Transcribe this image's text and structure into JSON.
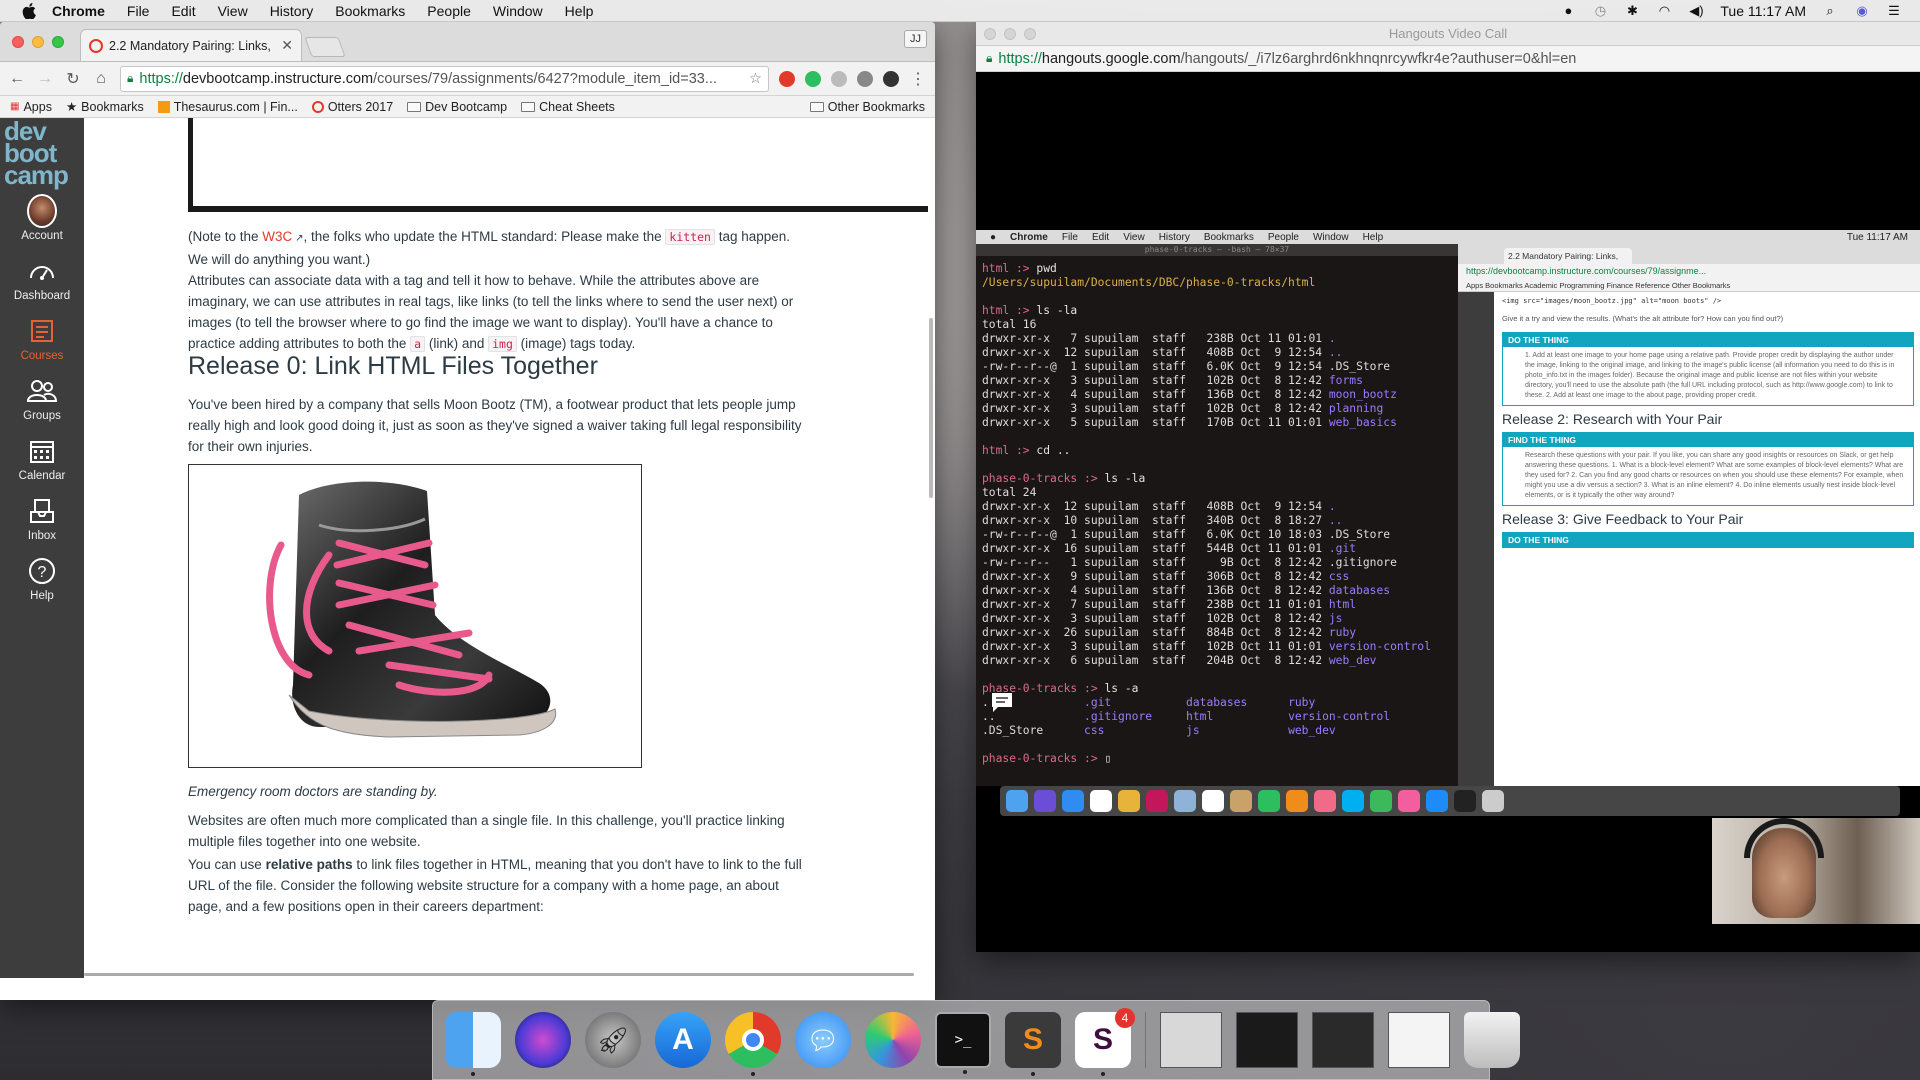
{
  "menubar": {
    "app": "Chrome",
    "items": [
      "File",
      "Edit",
      "View",
      "History",
      "Bookmarks",
      "People",
      "Window",
      "Help"
    ],
    "clock": "Tue 11:17 AM"
  },
  "left_window": {
    "tab_title": "2.2 Mandatory Pairing: Links, I",
    "profile": "JJ",
    "url_secure": "https://",
    "url_host": "devbootcamp.instructure.com",
    "url_path": "/courses/79/assignments/6427?module_item_id=33...",
    "bookmarks": [
      "Apps",
      "Bookmarks",
      "Thesaurus.com | Fin...",
      "Otters 2017",
      "Dev Bootcamp",
      "Cheat Sheets"
    ],
    "other_bookmarks": "Other Bookmarks"
  },
  "canvas_nav": {
    "logo": [
      "dev",
      "boot",
      "camp"
    ],
    "items": [
      "Account",
      "Dashboard",
      "Courses",
      "Groups",
      "Calendar",
      "Inbox",
      "Help"
    ]
  },
  "content": {
    "p1_a": "(Note to the ",
    "p1_link": "W3C",
    "p1_b": ", the folks who update the HTML standard: Please make the ",
    "p1_code": "kitten",
    "p1_c": " tag happen. We will do anything you want.)",
    "p2_a": "Attributes can associate data with a tag and tell it how to behave. While the attributes above are imaginary, we can use attributes in real tags, like links (to tell the links where to send the user next) or images (to tell the browser where to go find the image we want to display). You'll have a chance to practice adding attributes to both the ",
    "p2_code1": "a",
    "p2_b": " (link) and ",
    "p2_code2": "img",
    "p2_c": " (image) tags today.",
    "heading": "Release 0: Link HTML Files Together",
    "p3": "You've been hired by a company that sells Moon Bootz (TM), a footwear product that lets people jump really high and look good doing it, just as soon as they've signed a waiver taking full legal responsibility for their own injuries.",
    "caption": "Emergency room doctors are standing by.",
    "p4": "Websites are often much more complicated than a single file. In this challenge, you'll practice linking multiple files together into one website.",
    "p5_a": "You can use ",
    "p5_bold": "relative paths",
    "p5_b": " to link files together in HTML, meaning that you don't have to link to the full URL of the file. Consider the following website structure for a company with a home page, an about page, and a few positions open in their careers department:"
  },
  "hangouts": {
    "title": "Hangouts Video Call",
    "url_secure": "https://",
    "url_host": "hangouts.google.com",
    "url_path": "/hangouts/_/i7lz6arghrd6nkhnqnrcywfkr4e?authuser=0&hl=en"
  },
  "shared_screen": {
    "menubar": [
      "Chrome",
      "File",
      "Edit",
      "View",
      "History",
      "Bookmarks",
      "People",
      "Window",
      "Help"
    ],
    "clock": "Tue 11:17 AM",
    "terminal_title": "phase-0-tracks — -bash — 78×37",
    "terminal_lines": [
      {
        "p": "html :> ",
        "c": "pwd"
      },
      {
        "t": "/Users/supuilam/Documents/DBC/phase-0-tracks/html",
        "cls": "t-path"
      },
      {
        "t": ""
      },
      {
        "p": "html :> ",
        "c": "ls -la"
      },
      {
        "t": "total 16"
      },
      {
        "t": "drwxr-xr-x   7 supuilam  staff   238B Oct 11 01:01 ",
        "d": "."
      },
      {
        "t": "drwxr-xr-x  12 supuilam  staff   408B Oct  9 12:54 ",
        "d": ".."
      },
      {
        "t": "-rw-r--r--@  1 supuilam  staff   6.0K Oct  9 12:54 .DS_Store"
      },
      {
        "t": "drwxr-xr-x   3 supuilam  staff   102B Oct  8 12:42 ",
        "d": "forms"
      },
      {
        "t": "drwxr-xr-x   4 supuilam  staff   136B Oct  8 12:42 ",
        "d": "moon_bootz"
      },
      {
        "t": "drwxr-xr-x   3 supuilam  staff   102B Oct  8 12:42 ",
        "d": "planning"
      },
      {
        "t": "drwxr-xr-x   5 supuilam  staff   170B Oct 11 01:01 ",
        "d": "web_basics"
      },
      {
        "t": ""
      },
      {
        "p": "html :> ",
        "c": "cd .."
      },
      {
        "t": ""
      },
      {
        "p": "phase-0-tracks :> ",
        "c": "ls -la"
      },
      {
        "t": "total 24"
      },
      {
        "t": "drwxr-xr-x  12 supuilam  staff   408B Oct  9 12:54 ",
        "d": "."
      },
      {
        "t": "drwxr-xr-x  10 supuilam  staff   340B Oct  8 18:27 ",
        "d": ".."
      },
      {
        "t": "-rw-r--r--@  1 supuilam  staff   6.0K Oct 10 18:03 .DS_Store"
      },
      {
        "t": "drwxr-xr-x  16 supuilam  staff   544B Oct 11 01:01 ",
        "d": ".git"
      },
      {
        "t": "-rw-r--r--   1 supuilam  staff     9B Oct  8 12:42 .gitignore"
      },
      {
        "t": "drwxr-xr-x   9 supuilam  staff   306B Oct  8 12:42 ",
        "d": "css"
      },
      {
        "t": "drwxr-xr-x   4 supuilam  staff   136B Oct  8 12:42 ",
        "d": "databases"
      },
      {
        "t": "drwxr-xr-x   7 supuilam  staff   238B Oct 11 01:01 ",
        "d": "html"
      },
      {
        "t": "drwxr-xr-x   3 supuilam  staff   102B Oct  8 12:42 ",
        "d": "js"
      },
      {
        "t": "drwxr-xr-x  26 supuilam  staff   884B Oct  8 12:42 ",
        "d": "ruby"
      },
      {
        "t": "drwxr-xr-x   3 supuilam  staff   102B Oct 11 01:01 ",
        "d": "version-control"
      },
      {
        "t": "drwxr-xr-x   6 supuilam  staff   204B Oct  8 12:42 ",
        "d": "web_dev"
      },
      {
        "t": ""
      },
      {
        "p": "phase-0-tracks :> ",
        "c": "ls -a"
      },
      {
        "t": ".              ",
        "d": ".git           databases      ruby"
      },
      {
        "t": "..             ",
        "d": ".gitignore     html           version-control"
      },
      {
        "t": ".DS_Store      ",
        "d": "css            js             web_dev"
      },
      {
        "t": ""
      },
      {
        "p": "phase-0-tracks :> ",
        "c": "▯"
      }
    ],
    "mini_tab": "2.2 Mandatory Pairing: Links,",
    "mini_url": "https://devbootcamp.instructure.com/courses/79/assignme...",
    "mini_bookmarks": "Apps   Bookmarks   Academic   Programming   Finance   Reference   Other Bookmarks",
    "mini_code": "<img src=\"images/moon_bootz.jpg\" alt=\"moon boots\" />",
    "mini_p": "Give it a try and view the results. (What's the alt attribute for? How can you find out?)",
    "box1_title": "DO THE THING",
    "box1_text": "1. Add at least one image to your home page using a relative path. Provide proper credit by displaying the author under the image, linking to the original image, and linking to the image's public license (all information you need to do this is in photo_info.txt in the images folder). Because the original image and public license are not files within your website directory, you'll need to use the absolute path (the full URL including protocol, such as http://www.google.com) to link to these. 2. Add at least one image to the about page, providing proper credit.",
    "release2": "Release 2: Research with Your Pair",
    "box2_title": "FIND THE THING",
    "box2_text": "Research these questions with your pair. If you like, you can share any good insights or resources on Slack, or get help answering these questions. 1. What is a block-level element? What are some examples of block-level elements? What are they used for? 2. Can you find any good charts or resources on when you should use these elements? For example, when might you use a div versus a section? 3. What is an inline element? 4. Do inline elements usually nest inside block-level elements, or is it typically the other way around?",
    "release3": "Release 3: Give Feedback to Your Pair",
    "box3_title": "DO THE THING"
  },
  "dock": {
    "slack_badge": "4"
  },
  "colors": {
    "canvas_accent": "#e66135",
    "canvas_nav_bg": "#3d3d3d",
    "dbc_teal": "#12a5bf"
  }
}
